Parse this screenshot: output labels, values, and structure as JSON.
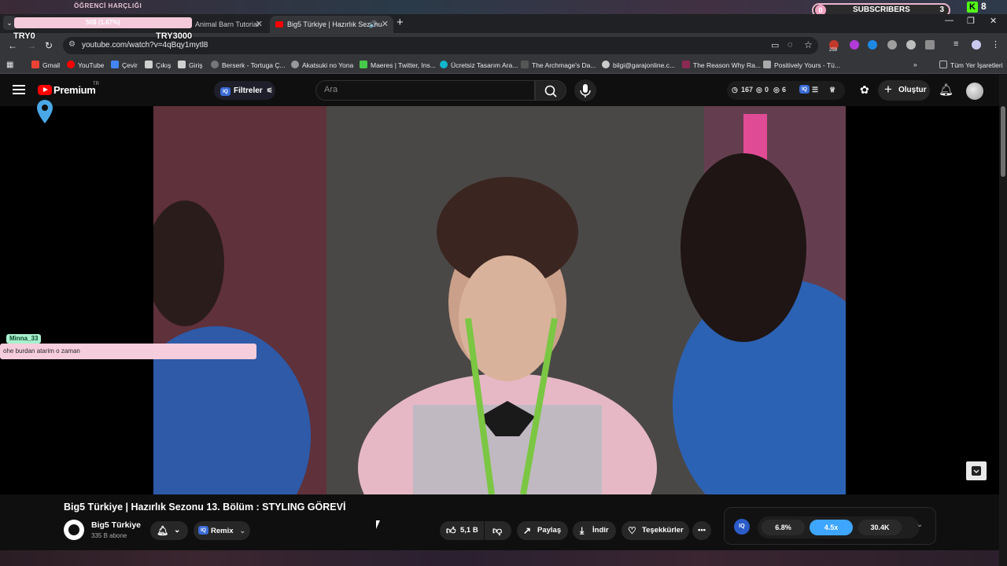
{
  "overlay": {
    "top_caption": "ÖĞRENCİ HARÇLIĞI",
    "progress_label": "50$ (1.67%)",
    "left_stat": "TRY0",
    "goal_stat": "TRY3000",
    "subscribers": {
      "current": "0",
      "label": "SUBSCRIBERS",
      "goal": "3"
    },
    "kick_count": "8",
    "chat": {
      "user": "Minna_33",
      "message": "ohe burdan atarim o zaman"
    }
  },
  "browser": {
    "tabs": [
      {
        "title": "Animal Barn Tutorial"
      },
      {
        "title": "Big5 Türkiye | Hazırlık Sezonu"
      }
    ],
    "url": "youtube.com/watch?v=4qBqy1mytl8",
    "bookmarks": [
      {
        "label": "Gmail",
        "color": "#ea4335"
      },
      {
        "label": "YouTube",
        "color": "#ff0000"
      },
      {
        "label": "Çevir",
        "color": "#4285f4"
      },
      {
        "label": "Çıkış",
        "color": "#d0d0d0"
      },
      {
        "label": "Giriş",
        "color": "#d0d0d0"
      },
      {
        "label": "Berserk - Tortuga Ç...",
        "color": "#777777"
      },
      {
        "label": "Akatsuki no Yona",
        "color": "#999999"
      },
      {
        "label": "Maeres | Twitter, Ins...",
        "color": "#47c94a"
      },
      {
        "label": "Ücretsiz Tasarım Ara...",
        "color": "#12b5cb"
      },
      {
        "label": "The Archmage's Da...",
        "color": "#555555"
      },
      {
        "label": "bilgi@garajonline.c...",
        "color": "#cccccc"
      },
      {
        "label": "The Reason Why Ra...",
        "color": "#8a2a55"
      },
      {
        "label": "Positively Yours - Tü...",
        "color": "#aaaaaa"
      }
    ],
    "all_bookmarks_label": "Tüm Yer İşaretleri",
    "extension_badge": "259"
  },
  "youtube": {
    "logo_label": "Premium",
    "region": "TR",
    "filters_label": "Filtreler",
    "search_placeholder": "Ara",
    "stats": {
      "views": "167",
      "a": "0",
      "b": "6"
    },
    "create_label": "Oluştur"
  },
  "video": {
    "title": "Big5 Türkiye | Hazırlık Sezonu 13. Bölüm : STYLING GÖREVİ",
    "channel": "Big5 Türkiye",
    "subscribers": "335 B abone",
    "remix_label": "Remix",
    "likes": "5,1 B",
    "share_label": "Paylaş",
    "download_label": "İndir",
    "thanks_label": "Teşekkürler"
  },
  "iq_panel": {
    "badge": "IQ",
    "values": [
      "6.8%",
      "4.5x",
      "30.4K"
    ],
    "accent": "#3ea6ff"
  }
}
